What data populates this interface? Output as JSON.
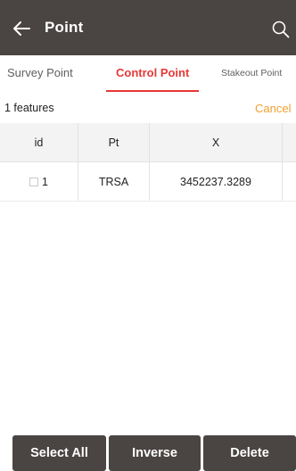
{
  "header": {
    "title": "Point"
  },
  "tabs": [
    {
      "label": "Survey Point",
      "active": false
    },
    {
      "label": "Control Point",
      "active": true
    },
    {
      "label": "Stakeout Point",
      "active": false
    }
  ],
  "toolbar": {
    "feature_count": "1 features",
    "cancel_label": "Cancel"
  },
  "table": {
    "columns": [
      "id",
      "Pt",
      "X"
    ],
    "rows": [
      {
        "id": "1",
        "pt": "TRSA",
        "x": "3452237.3289",
        "checked": false
      }
    ]
  },
  "actions": {
    "select_all_label": "Select All",
    "inverse_label": "Inverse",
    "delete_label": "Delete"
  },
  "colors": {
    "header_bg": "#4a4442",
    "active_tab": "#e53935",
    "cancel": "#f0a030",
    "button_bg": "#4a4442"
  }
}
